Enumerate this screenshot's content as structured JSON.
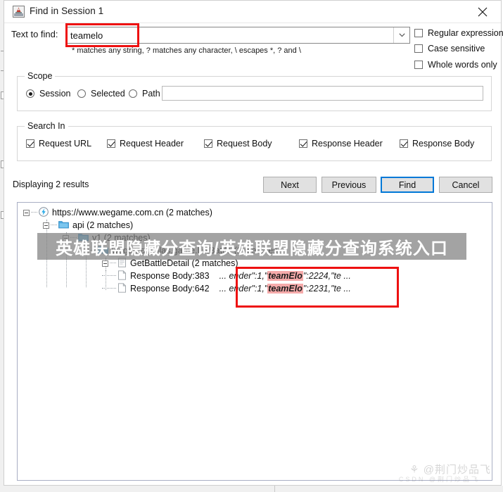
{
  "window": {
    "title": "Find in Session 1",
    "icon": "fiddler-app-icon",
    "close_icon": "close-icon"
  },
  "find": {
    "label": "Text to find:",
    "value": "teamelo",
    "placeholder": "",
    "dropdown_icon": "chevron-down-icon",
    "hint": "* matches any string, ? matches any character, \\ escapes *, ? and \\"
  },
  "options": [
    {
      "label": "Regular expression",
      "checked": false
    },
    {
      "label": "Case sensitive",
      "checked": false
    },
    {
      "label": "Whole words only",
      "checked": false
    }
  ],
  "scope": {
    "title": "Scope",
    "radios": [
      {
        "label": "Session",
        "checked": true
      },
      {
        "label": "Selected",
        "checked": false
      },
      {
        "label": "Path",
        "checked": false
      }
    ],
    "path_value": ""
  },
  "search_in": {
    "title": "Search In",
    "checkboxes": [
      {
        "label": "Request URL",
        "checked": true
      },
      {
        "label": "Request Header",
        "checked": true
      },
      {
        "label": "Request Body",
        "checked": true
      },
      {
        "label": "Response Header",
        "checked": true
      },
      {
        "label": "Response Body",
        "checked": true
      }
    ]
  },
  "status": "Displaying 2 results",
  "buttons": {
    "next": "Next",
    "previous": "Previous",
    "find": "Find",
    "cancel": "Cancel"
  },
  "results_tree": {
    "host": {
      "label": "https://www.wegame.com.cn (2 matches)",
      "icon": "lightning-bolt-icon"
    },
    "api": {
      "label": "api (2 matches)",
      "icon": "folder-icon"
    },
    "level3": {
      "label": "v1 (2 matches)",
      "icon": "folder-icon"
    },
    "service": {
      "label": "wegame.pallas.game.LolBattle (2 matches)",
      "icon": "folder-icon"
    },
    "method": {
      "label": "GetBattleDetail (2 matches)",
      "icon": "page-icon"
    },
    "matches": [
      {
        "label": "Response Body:383",
        "icon": "document-icon",
        "prefix": "... ender\":1,\"",
        "highlight": "teamElo",
        "suffix": "\":2224,\"te ..."
      },
      {
        "label": "Response Body:642",
        "icon": "document-icon",
        "prefix": "... ender\":1,\"",
        "highlight": "teamElo",
        "suffix": "\":2231,\"te ..."
      }
    ]
  },
  "annotations": {
    "red_box_input": "red-highlight-box",
    "red_box_matches": "red-highlight-box"
  },
  "watermarks": {
    "banner": "英雄联盟隐藏分查询/英雄联盟隐藏分查询系统入口",
    "credit": "⚘ @荆门炒品飞",
    "credit_sub": "CSDN @荆门炒品飞"
  },
  "colors": {
    "accent": "#0078d7",
    "highlight": "#f5aaaa",
    "annotation": "#ee1111",
    "folder": "#4aa8e0"
  }
}
